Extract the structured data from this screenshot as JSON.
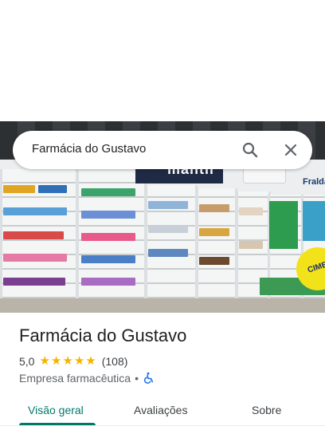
{
  "search": {
    "query": "Farmácia do Gustavo"
  },
  "photo": {
    "sign_text": "mantil",
    "fraldas_text": "Fraldas",
    "badge_text": "CIME"
  },
  "place": {
    "name": "Farmácia do Gustavo",
    "rating": "5,0",
    "stars": 5,
    "reviews_count": "(108)",
    "category": "Empresa farmacêutica",
    "separator": "•"
  },
  "tabs": [
    {
      "label": "Visão geral",
      "active": true
    },
    {
      "label": "Avaliações",
      "active": false
    },
    {
      "label": "Sobre",
      "active": false
    }
  ],
  "colors": {
    "accent": "#00796b",
    "star": "#f4b400",
    "accessibility": "#1a73e8"
  },
  "icons": [
    "search-icon",
    "close-icon",
    "star-icon",
    "wheelchair-icon"
  ]
}
